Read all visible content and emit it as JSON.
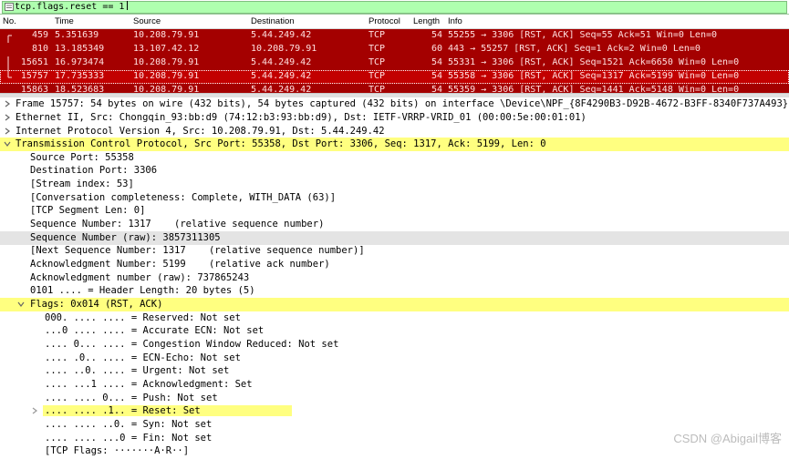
{
  "filter": {
    "text": "tcp.flags.reset == 1"
  },
  "columns": [
    "No.",
    "Time",
    "Source",
    "Destination",
    "Protocol",
    "Length",
    "Info"
  ],
  "packets": [
    {
      "no": "459",
      "time": "5.351639",
      "source": "10.208.79.91",
      "destination": "5.44.249.42",
      "protocol": "TCP",
      "length": "54",
      "info": "55255 → 3306 [RST, ACK] Seq=55 Ack=51 Win=0 Len=0"
    },
    {
      "no": "810",
      "time": "13.185349",
      "source": "13.107.42.12",
      "destination": "10.208.79.91",
      "protocol": "TCP",
      "length": "60",
      "info": "443 → 55257 [RST, ACK] Seq=1 Ack=2 Win=0 Len=0"
    },
    {
      "no": "15651",
      "time": "16.973474",
      "source": "10.208.79.91",
      "destination": "5.44.249.42",
      "protocol": "TCP",
      "length": "54",
      "info": "55331 → 3306 [RST, ACK] Seq=1521 Ack=6650 Win=0 Len=0"
    },
    {
      "no": "15757",
      "time": "17.735333",
      "source": "10.208.79.91",
      "destination": "5.44.249.42",
      "protocol": "TCP",
      "length": "54",
      "info": "55358 → 3306 [RST, ACK] Seq=1317 Ack=5199 Win=0 Len=0"
    },
    {
      "no": "15863",
      "time": "18.523683",
      "source": "10.208.79.91",
      "destination": "5.44.249.42",
      "protocol": "TCP",
      "length": "54",
      "info": "55359 → 3306 [RST, ACK] Seq=1441 Ack=5148 Win=0 Len=0"
    }
  ],
  "details": [
    {
      "text": "Frame 15757: 54 bytes on wire (432 bits), 54 bytes captured (432 bits) on interface \\Device\\NPF_{8F4290B3-D92B-4672-B3FF-8340F737A493}, id",
      "arrow": "right"
    },
    {
      "text": "Ethernet II, Src: Chongqin_93:bb:d9 (74:12:b3:93:bb:d9), Dst: IETF-VRRP-VRID_01 (00:00:5e:00:01:01)",
      "arrow": "right"
    },
    {
      "text": "Internet Protocol Version 4, Src: 10.208.79.91, Dst: 5.44.249.42",
      "arrow": "right"
    },
    {
      "text": "Transmission Control Protocol, Src Port: 55358, Dst Port: 3306, Seq: 1317, Ack: 5199, Len: 0",
      "arrow": "down",
      "hl": "yellow"
    },
    {
      "text": "Source Port: 55358"
    },
    {
      "text": "Destination Port: 3306"
    },
    {
      "text": "[Stream index: 53]"
    },
    {
      "text": "[Conversation completeness: Complete, WITH_DATA (63)]"
    },
    {
      "text": "[TCP Segment Len: 0]"
    },
    {
      "text": "Sequence Number: 1317    (relative sequence number)"
    },
    {
      "text": "Sequence Number (raw): 3857311305",
      "hl": "gray"
    },
    {
      "text": "[Next Sequence Number: 1317    (relative sequence number)]"
    },
    {
      "text": "Acknowledgment Number: 5199    (relative ack number)"
    },
    {
      "text": "Acknowledgment number (raw): 737865243"
    },
    {
      "text": "0101 .... = Header Length: 20 bytes (5)"
    },
    {
      "text": "Flags: 0x014 (RST, ACK)",
      "arrow": "down",
      "hl": "yellow"
    },
    {
      "text": "000. .... .... = Reserved: Not set"
    },
    {
      "text": "...0 .... .... = Accurate ECN: Not set"
    },
    {
      "text": ".... 0... .... = Congestion Window Reduced: Not set"
    },
    {
      "text": ".... .0.. .... = ECN-Echo: Not set"
    },
    {
      "text": ".... ..0. .... = Urgent: Not set"
    },
    {
      "text": ".... ...1 .... = Acknowledgment: Set"
    },
    {
      "text": ".... .... 0... = Push: Not set"
    },
    {
      "text": ".... .... .1.. = Reset: Set",
      "arrow": "right",
      "hl": "yellow"
    },
    {
      "text": ".... .... ..0. = Syn: Not set"
    },
    {
      "text": ".... .... ...0 = Fin: Not set"
    },
    {
      "text": "[TCP Flags: ·······A·R··]"
    }
  ],
  "watermark": "CSDN @Abigail博客",
  "colors": {
    "row_bg": "#a40000",
    "row_text": "#ffe0e0",
    "filter_bg": "#afffaf",
    "highlight": "#ffff80"
  }
}
